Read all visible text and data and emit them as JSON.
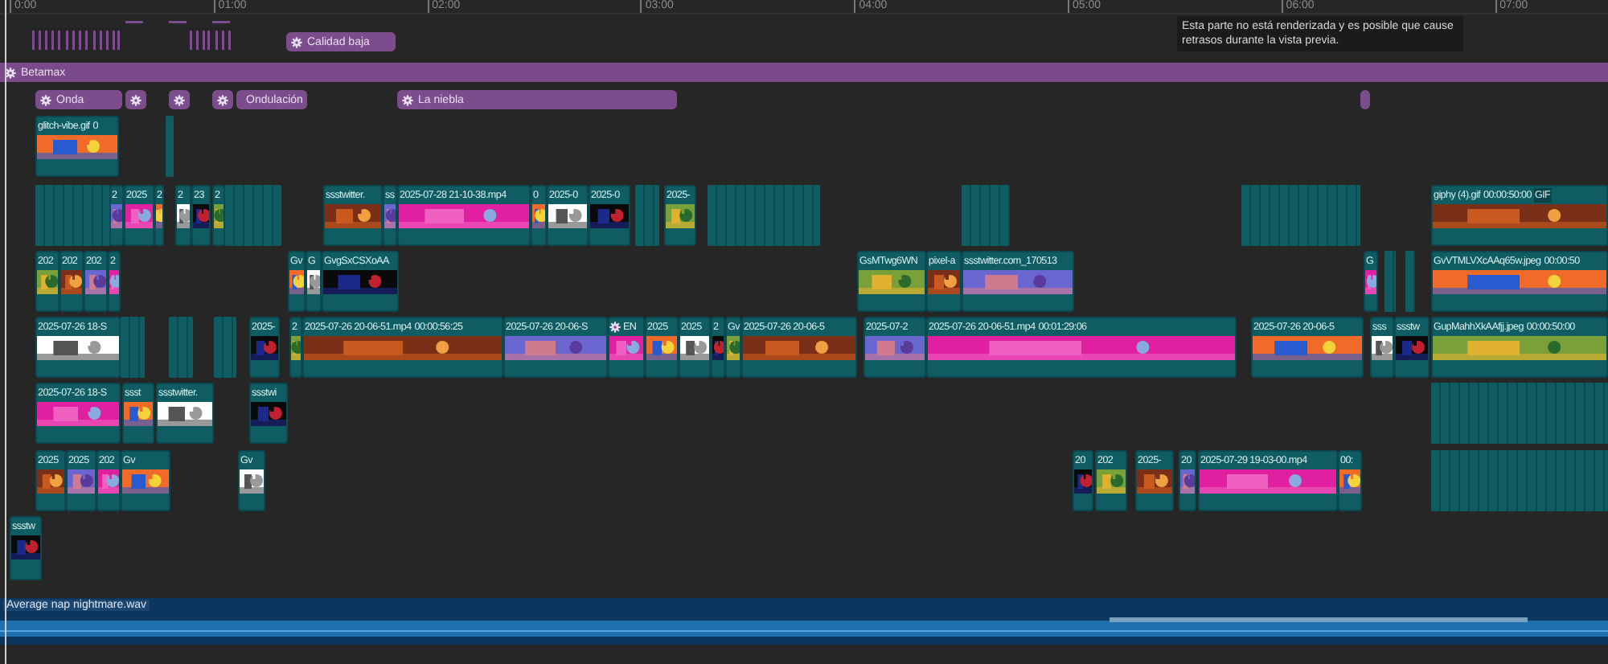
{
  "ruler": {
    "labels": [
      "0:00",
      "01:00",
      "02:00",
      "03:00",
      "04:00",
      "05:00",
      "06:00",
      "07:00"
    ]
  },
  "tooltip": {
    "text": "Esta parte no está renderizada y es posible que cause retrasos durante la vista previa."
  },
  "effect_rows": [
    {
      "effects": [
        {
          "kind": "labeled",
          "label": "Calidad baja"
        }
      ]
    },
    {
      "effects": [
        {
          "kind": "labeled",
          "label": "Betamax"
        }
      ]
    },
    {
      "effects": [
        {
          "kind": "labeled",
          "label": "Onda"
        },
        {
          "kind": "icon"
        },
        {
          "kind": "icon"
        },
        {
          "kind": "icon"
        },
        {
          "kind": "labeled",
          "label": "Ondulación"
        },
        {
          "kind": "labeled",
          "label": "La niebla"
        },
        {
          "kind": "stub"
        }
      ]
    }
  ],
  "tracks": [
    {
      "clips": [
        {
          "labels": [
            "glitch-vibe.gif",
            "0"
          ]
        }
      ]
    },
    {
      "clips": [
        {
          "labels": [
            "2"
          ]
        },
        {
          "labels": [
            "2025"
          ]
        },
        {
          "labels": [
            "2"
          ]
        },
        {
          "labels": [
            "2"
          ]
        },
        {
          "labels": [
            "23"
          ]
        },
        {
          "labels": [
            "2"
          ]
        },
        {
          "labels": [
            "ssstwitter."
          ]
        },
        {
          "labels": [
            "ss"
          ]
        },
        {
          "labels": [
            "2025-07-28 21-10-38.mp4"
          ]
        },
        {
          "labels": [
            "0"
          ]
        },
        {
          "labels": [
            "2025-0"
          ]
        },
        {
          "labels": [
            "2025-0"
          ]
        },
        {
          "labels": [
            "2025-"
          ]
        },
        {
          "labels": [
            "giphy (4).gif",
            "00:00:50:00",
            "GIF"
          ]
        }
      ]
    },
    {
      "clips": [
        {
          "labels": [
            "202"
          ]
        },
        {
          "labels": [
            "202"
          ]
        },
        {
          "labels": [
            "202"
          ]
        },
        {
          "labels": [
            "2"
          ]
        },
        {
          "labels": [
            "Gv"
          ]
        },
        {
          "labels": [
            "G"
          ]
        },
        {
          "labels": [
            "GvgSxCSXoAA"
          ]
        },
        {
          "labels": [
            "GsMTwg6WN"
          ]
        },
        {
          "labels": [
            "pixel-a"
          ]
        },
        {
          "labels": [
            "ssstwitter.com_170513"
          ]
        },
        {
          "labels": [
            "G"
          ]
        },
        {
          "labels": [
            "GvVTMLVXcAAq65w.jpeg",
            "00:00:50"
          ]
        }
      ]
    },
    {
      "clips": [
        {
          "labels": [
            "2025-07-26 18-S"
          ]
        },
        {
          "labels": [
            "2025-"
          ]
        },
        {
          "labels": [
            "2"
          ]
        },
        {
          "labels": [
            "2025-07-26 20-06-51.mp4",
            "00:00:56:25"
          ]
        },
        {
          "labels": [
            "2025-07-26 20-06-S"
          ]
        },
        {
          "labels": [
            "EN"
          ],
          "effect": true
        },
        {
          "labels": [
            "2025"
          ]
        },
        {
          "labels": [
            "2025"
          ]
        },
        {
          "labels": [
            "2"
          ]
        },
        {
          "labels": [
            "Gv"
          ]
        },
        {
          "labels": [
            "2025-07-26 20-06-5"
          ]
        },
        {
          "labels": [
            "2025-07-2"
          ]
        },
        {
          "labels": [
            "2025-07-26 20-06-51.mp4",
            "00:01:29:06"
          ]
        },
        {
          "labels": [
            "2025-07-26 20-06-5"
          ]
        },
        {
          "labels": [
            "sss"
          ]
        },
        {
          "labels": [
            "ssstw"
          ]
        },
        {
          "labels": [
            "GupMahhXkAAfjj.jpeg",
            "00:00:50:00"
          ]
        }
      ]
    },
    {
      "clips": [
        {
          "labels": [
            "2025-07-26 18-S"
          ]
        },
        {
          "labels": [
            "ssst"
          ]
        },
        {
          "labels": [
            "ssstwitter."
          ]
        },
        {
          "labels": [
            "ssstwi"
          ]
        }
      ]
    },
    {
      "clips": [
        {
          "labels": [
            "2025"
          ]
        },
        {
          "labels": [
            "2025"
          ]
        },
        {
          "labels": [
            "202"
          ]
        },
        {
          "labels": [
            "Gv"
          ]
        },
        {
          "labels": [
            "Gv"
          ]
        },
        {
          "labels": [
            "20"
          ]
        },
        {
          "labels": [
            "202"
          ]
        },
        {
          "labels": [
            "2025-"
          ]
        },
        {
          "labels": [
            "20"
          ]
        },
        {
          "labels": [
            "2025-07-29 19-03-00.mp4"
          ]
        },
        {
          "labels": [
            "00:"
          ]
        }
      ]
    },
    {
      "clips": [
        {
          "labels": [
            "ssstw"
          ]
        }
      ]
    }
  ],
  "audio": {
    "label": "Average nap nightmare.wav"
  }
}
